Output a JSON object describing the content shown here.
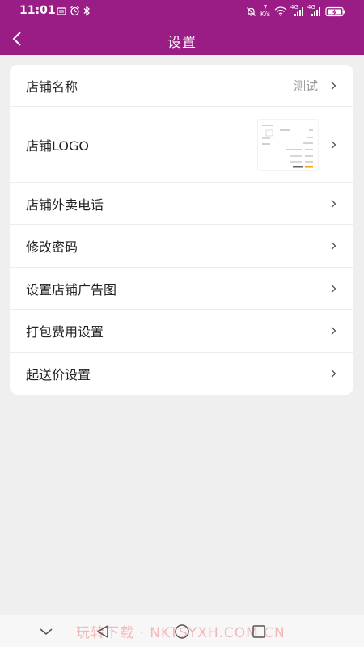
{
  "status_bar": {
    "time": "11:01",
    "network_speed_value": "7",
    "network_speed_unit": "K/s",
    "signal_1_label": "4G",
    "signal_2_label": "4G"
  },
  "nav": {
    "title": "设置"
  },
  "settings": {
    "rows": [
      {
        "label": "店铺名称",
        "value": "测试"
      },
      {
        "label": "店铺LOGO"
      },
      {
        "label": "店铺外卖电话"
      },
      {
        "label": "修改密码"
      },
      {
        "label": "设置店铺广告图"
      },
      {
        "label": "打包费用设置"
      },
      {
        "label": "起送价设置"
      }
    ]
  },
  "watermark": "玩转下载 · NKTSYXH.COM.CN",
  "colors": {
    "brand": "#9a1d86",
    "page_bg": "#efefef",
    "card_bg": "#ffffff",
    "text_primary": "#222222",
    "text_secondary": "#999999"
  },
  "icons": {
    "back": "chevron-left-icon",
    "row_arrow": "chevron-right-icon",
    "sys_nav": [
      "nav-hide-icon",
      "nav-back-icon",
      "nav-home-icon",
      "nav-recents-icon"
    ]
  }
}
